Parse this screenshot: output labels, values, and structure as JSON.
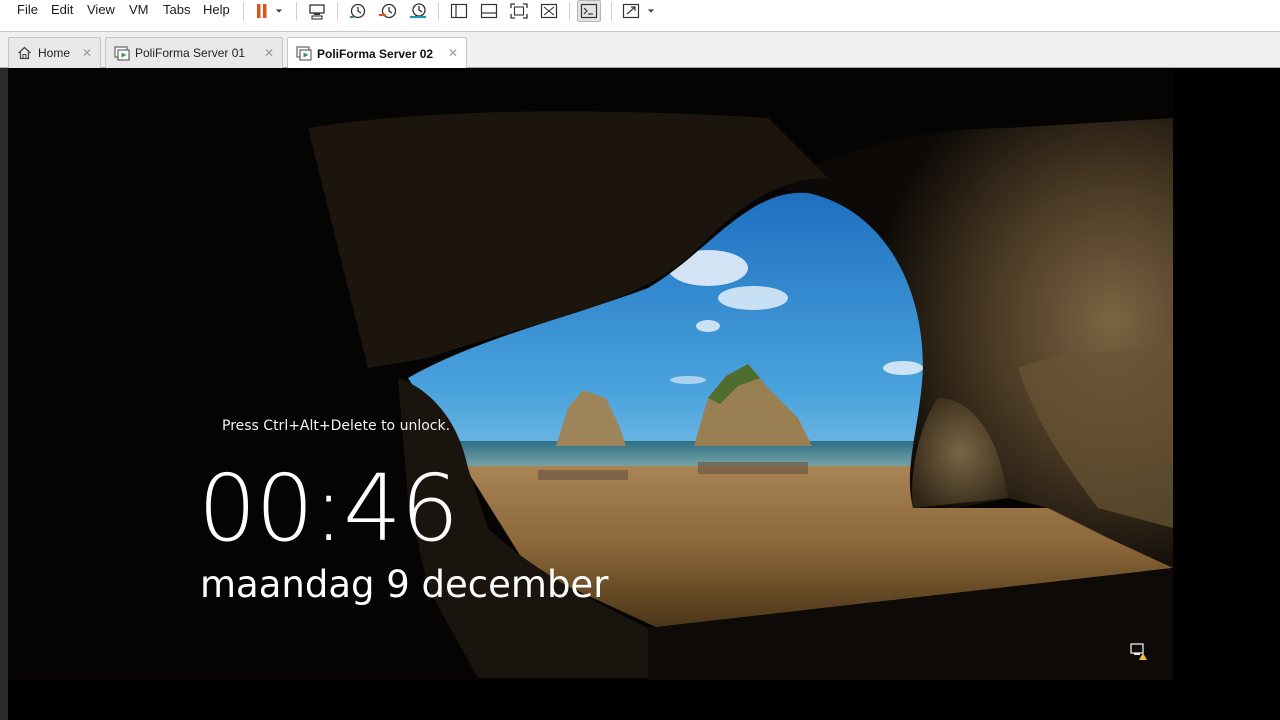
{
  "menu": {
    "file": "File",
    "edit": "Edit",
    "view": "View",
    "vm": "VM",
    "tabs": "Tabs",
    "help": "Help"
  },
  "toolbar": {
    "icons": [
      "pause-icon",
      "dropdown-arrow-icon",
      "send-ctrl-alt-del-icon",
      "snapshot-take-icon",
      "snapshot-revert-icon",
      "snapshot-manager-icon",
      "sidebar-toggle-icon",
      "thumbnail-bar-icon",
      "full-screen-icon",
      "unity-icon",
      "console-view-icon",
      "stretch-icon"
    ]
  },
  "tabs": [
    {
      "label": "Home",
      "icon": "home-icon"
    },
    {
      "label": "PoliForma Server 01",
      "icon": "vm-icon"
    },
    {
      "label": "PoliForma Server 02",
      "icon": "vm-icon",
      "active": true
    }
  ],
  "lockscreen": {
    "hint": "Press Ctrl+Alt+Delete to unlock.",
    "time": "00:46",
    "date": "maandag 9 december"
  },
  "colors": {
    "pause_accent": "#e0531f",
    "vm_icon_green": "#2f9e41",
    "screen_bg": "#000000",
    "sky": "#3b8fd0",
    "sand": "#9a7444"
  }
}
